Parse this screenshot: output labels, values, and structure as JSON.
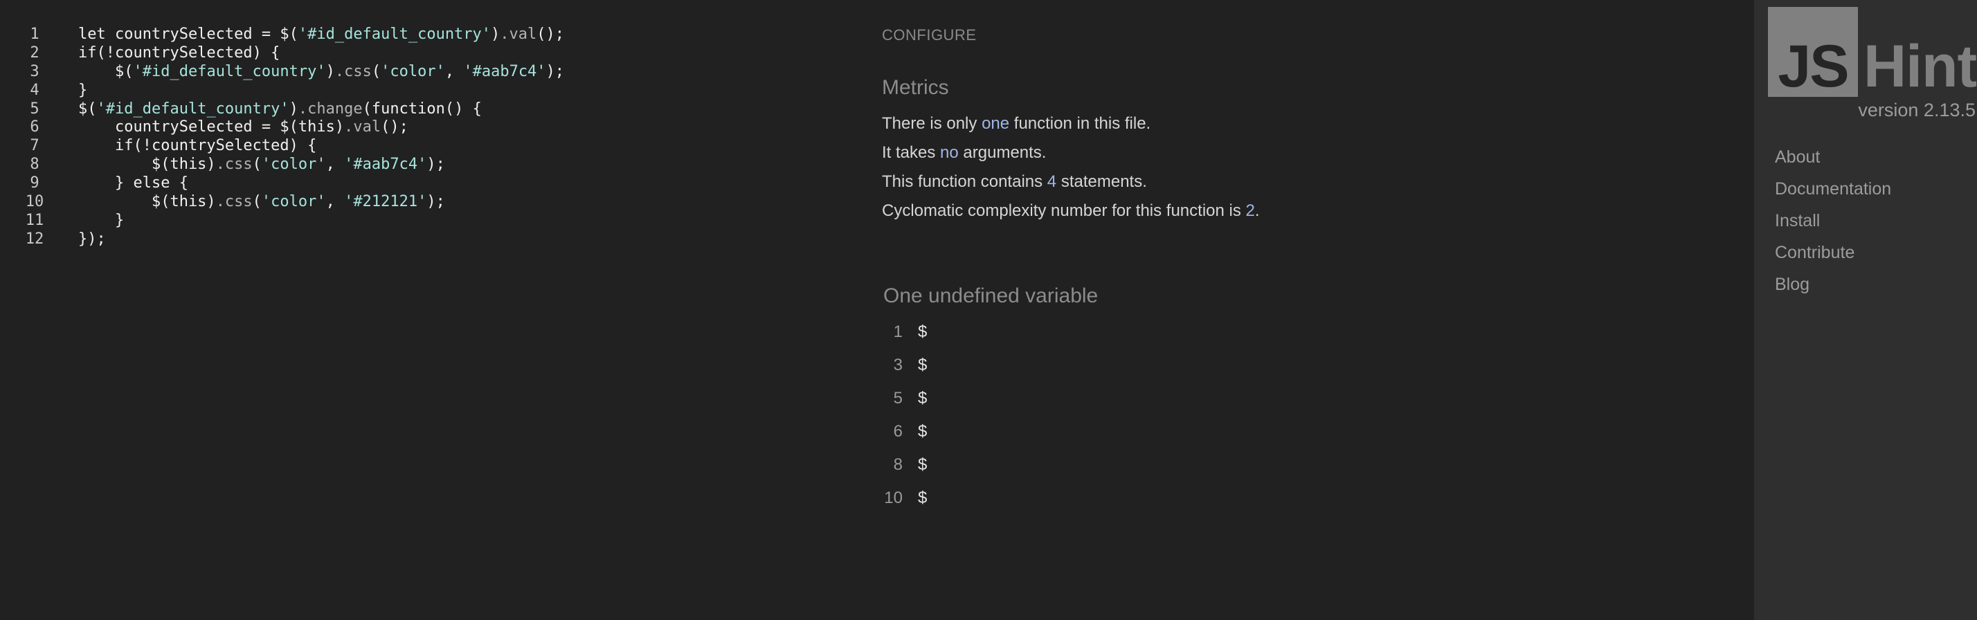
{
  "editor": {
    "lines": [
      {
        "num": "1",
        "tokens": [
          {
            "t": "let countrySelected = $(",
            "c": "plain"
          },
          {
            "t": "'#id_default_country'",
            "c": "str"
          },
          {
            "t": ")",
            "c": "plain"
          },
          {
            "t": ".val",
            "c": "fn"
          },
          {
            "t": "();",
            "c": "plain"
          }
        ]
      },
      {
        "num": "2",
        "tokens": [
          {
            "t": "if(!countrySelected) {",
            "c": "plain"
          }
        ]
      },
      {
        "num": "3",
        "tokens": [
          {
            "t": "    $(",
            "c": "plain"
          },
          {
            "t": "'#id_default_country'",
            "c": "str"
          },
          {
            "t": ")",
            "c": "plain"
          },
          {
            "t": ".css",
            "c": "fn"
          },
          {
            "t": "(",
            "c": "plain"
          },
          {
            "t": "'color'",
            "c": "str"
          },
          {
            "t": ", ",
            "c": "plain"
          },
          {
            "t": "'#aab7c4'",
            "c": "str"
          },
          {
            "t": ");",
            "c": "plain"
          }
        ]
      },
      {
        "num": "4",
        "tokens": [
          {
            "t": "}",
            "c": "plain"
          }
        ]
      },
      {
        "num": "5",
        "tokens": [
          {
            "t": "$(",
            "c": "plain"
          },
          {
            "t": "'#id_default_country'",
            "c": "str"
          },
          {
            "t": ")",
            "c": "plain"
          },
          {
            "t": ".change",
            "c": "fn"
          },
          {
            "t": "(function() {",
            "c": "plain"
          }
        ]
      },
      {
        "num": "6",
        "tokens": [
          {
            "t": "    countrySelected = $(this)",
            "c": "plain"
          },
          {
            "t": ".val",
            "c": "fn"
          },
          {
            "t": "();",
            "c": "plain"
          }
        ]
      },
      {
        "num": "7",
        "tokens": [
          {
            "t": "    if(!countrySelected) {",
            "c": "plain"
          }
        ]
      },
      {
        "num": "8",
        "tokens": [
          {
            "t": "        $(this)",
            "c": "plain"
          },
          {
            "t": ".css",
            "c": "fn"
          },
          {
            "t": "(",
            "c": "plain"
          },
          {
            "t": "'color'",
            "c": "str"
          },
          {
            "t": ", ",
            "c": "plain"
          },
          {
            "t": "'#aab7c4'",
            "c": "str"
          },
          {
            "t": ");",
            "c": "plain"
          }
        ]
      },
      {
        "num": "9",
        "tokens": [
          {
            "t": "    } else {",
            "c": "plain"
          }
        ]
      },
      {
        "num": "10",
        "tokens": [
          {
            "t": "        $(this)",
            "c": "plain"
          },
          {
            "t": ".css",
            "c": "fn"
          },
          {
            "t": "(",
            "c": "plain"
          },
          {
            "t": "'color'",
            "c": "str"
          },
          {
            "t": ", ",
            "c": "plain"
          },
          {
            "t": "'#212121'",
            "c": "str"
          },
          {
            "t": ");",
            "c": "plain"
          }
        ]
      },
      {
        "num": "11",
        "tokens": [
          {
            "t": "    }",
            "c": "plain"
          }
        ]
      },
      {
        "num": "12",
        "tokens": [
          {
            "t": "});",
            "c": "plain"
          }
        ]
      }
    ]
  },
  "report": {
    "configure_label": "CONFIGURE",
    "metrics_title": "Metrics",
    "metrics": [
      {
        "before": "There is only ",
        "value": "one",
        "after": " function in this file."
      },
      {
        "before": "It takes ",
        "value": "no",
        "after": " arguments."
      },
      {
        "before": "This function contains ",
        "value": "4",
        "after": " statements."
      },
      {
        "before": "Cyclomatic complexity number for this function is ",
        "value": "2",
        "after": "."
      }
    ],
    "undefined_title": "One undefined variable",
    "undefined_vars": [
      {
        "line": "1",
        "name": "$"
      },
      {
        "line": "3",
        "name": "$"
      },
      {
        "line": "5",
        "name": "$"
      },
      {
        "line": "6",
        "name": "$"
      },
      {
        "line": "8",
        "name": "$"
      },
      {
        "line": "10",
        "name": "$"
      }
    ]
  },
  "sidebar": {
    "logo_js": "JS",
    "logo_hint": "Hint",
    "version": "version 2.13.5",
    "nav": [
      "About",
      "Documentation",
      "Install",
      "Contribute",
      "Blog"
    ]
  },
  "colors": {
    "background": "#212121",
    "sidebar_background": "#2f2f2f",
    "string_token": "#a6e3dc",
    "highlight_value": "#9fb6e6",
    "logo_gray": "#808080"
  }
}
